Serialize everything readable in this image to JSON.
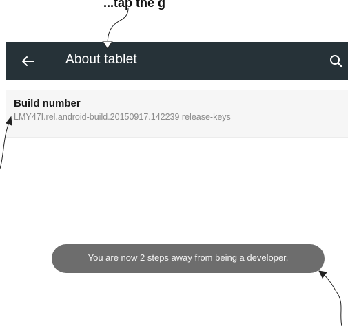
{
  "top_caption": "...tap the g",
  "toolbar": {
    "back_icon": "arrow-left-icon",
    "title": "About tablet",
    "search_icon": "search-icon",
    "background": "#263238"
  },
  "build_number": {
    "title": "Build number",
    "summary": "LMY47I.rel.android-build.20150917.142239 release-keys"
  },
  "toast": {
    "message": "You are now 2 steps away from being a developer."
  }
}
